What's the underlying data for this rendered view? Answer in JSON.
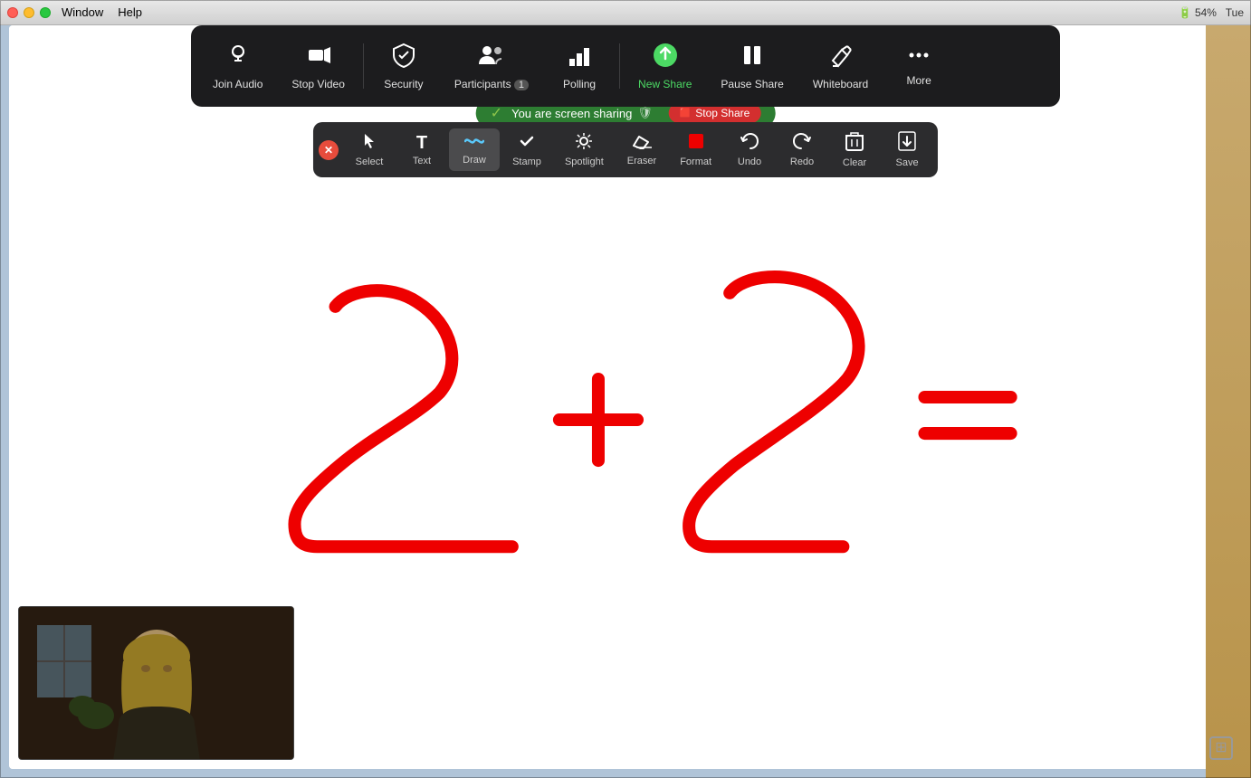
{
  "titleBar": {
    "menu": [
      "Window",
      "Help"
    ],
    "batteryPercent": "54%",
    "time": "Tue"
  },
  "zoomToolbar": {
    "items": [
      {
        "id": "join-audio",
        "label": "Join Audio",
        "icon": "🎧",
        "hasDropdown": true
      },
      {
        "id": "stop-video",
        "label": "Stop Video",
        "icon": "📹",
        "hasDropdown": true
      },
      {
        "id": "security",
        "label": "Security",
        "icon": "🛡",
        "hasDropdown": false
      },
      {
        "id": "participants",
        "label": "Participants",
        "icon": "👥",
        "hasDropdown": true,
        "badge": "1"
      },
      {
        "id": "polling",
        "label": "Polling",
        "icon": "📊",
        "hasDropdown": false
      },
      {
        "id": "new-share",
        "label": "New Share",
        "icon": "↑",
        "hasDropdown": false,
        "isActive": true
      },
      {
        "id": "pause-share",
        "label": "Pause Share",
        "icon": "⏸",
        "hasDropdown": false
      },
      {
        "id": "whiteboard",
        "label": "Whiteboard",
        "icon": "✏",
        "hasDropdown": false
      },
      {
        "id": "more",
        "label": "More",
        "icon": "•••",
        "hasDropdown": false
      }
    ]
  },
  "shareBanner": {
    "text": "You are screen sharing",
    "stopLabel": "Stop Share",
    "shieldIcon": "🛡"
  },
  "annotationToolbar": {
    "items": [
      {
        "id": "select",
        "label": "Select",
        "icon": "✥",
        "active": false
      },
      {
        "id": "text",
        "label": "Text",
        "icon": "T",
        "active": false
      },
      {
        "id": "draw",
        "label": "Draw",
        "icon": "〜",
        "active": true
      },
      {
        "id": "stamp",
        "label": "Stamp",
        "icon": "✓",
        "active": false
      },
      {
        "id": "spotlight",
        "label": "Spotlight",
        "icon": "✦",
        "active": false
      },
      {
        "id": "eraser",
        "label": "Eraser",
        "icon": "◇",
        "active": false
      },
      {
        "id": "format",
        "label": "Format",
        "icon": "■",
        "active": false,
        "isRed": true
      },
      {
        "id": "undo",
        "label": "Undo",
        "icon": "↺",
        "active": false
      },
      {
        "id": "redo",
        "label": "Redo",
        "icon": "↻",
        "active": false
      },
      {
        "id": "clear",
        "label": "Clear",
        "icon": "🗑",
        "active": false
      },
      {
        "id": "save",
        "label": "Save",
        "icon": "⬇",
        "active": false
      }
    ]
  },
  "expandButton": "⊞",
  "windowMenuItems": [
    "Window",
    "Help"
  ]
}
